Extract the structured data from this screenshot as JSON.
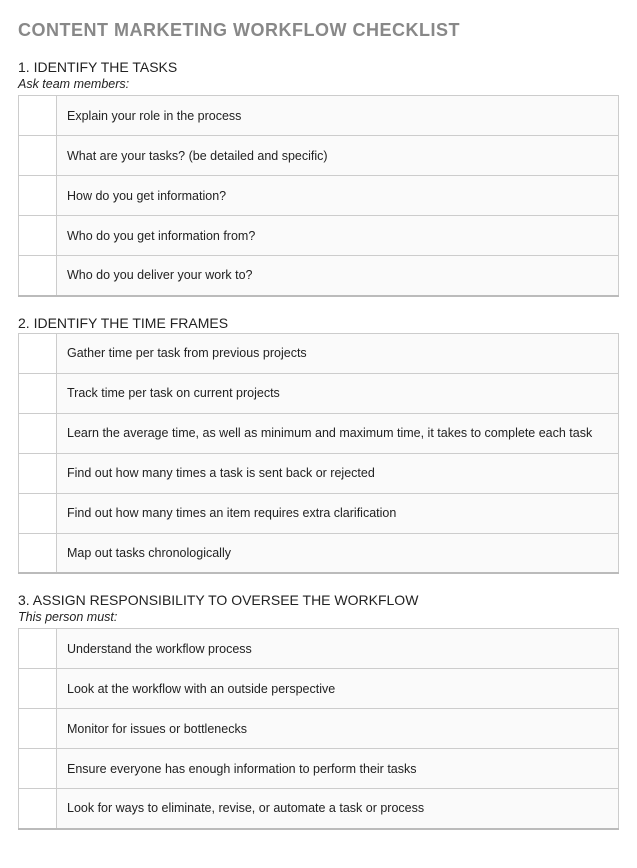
{
  "title": "CONTENT MARKETING WORKFLOW CHECKLIST",
  "sections": [
    {
      "heading": "1. IDENTIFY THE TASKS",
      "subheading": "Ask team members:",
      "items": [
        "Explain your role in the process",
        "What are your tasks? (be detailed and specific)",
        "How do you get information?",
        "Who do you get information from?",
        "Who do you deliver your work to?"
      ]
    },
    {
      "heading": "2. IDENTIFY THE TIME FRAMES",
      "subheading": "",
      "items": [
        "Gather time per task from previous projects",
        "Track time per task on current projects",
        "Learn the average time, as well as minimum and maximum time, it takes to complete each task",
        "Find out how many times a task is sent back or rejected",
        "Find out how many times an item requires extra clarification",
        "Map out tasks chronologically"
      ]
    },
    {
      "heading": "3. ASSIGN RESPONSIBILITY TO OVERSEE THE WORKFLOW",
      "subheading": "This person must:",
      "items": [
        "Understand the workflow process",
        "Look at the workflow with an outside perspective",
        "Monitor for issues or bottlenecks",
        "Ensure everyone has enough information to perform their tasks",
        "Look for ways to eliminate, revise, or automate a task or process"
      ]
    }
  ]
}
